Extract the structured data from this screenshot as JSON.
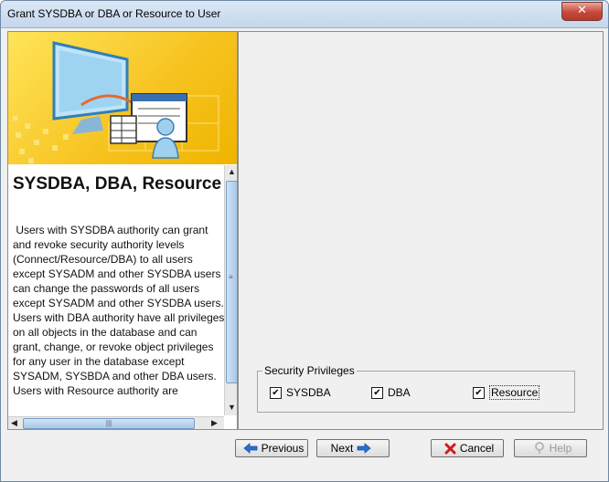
{
  "window": {
    "title": "Grant SYSDBA or DBA or Resource to User",
    "close_glyph": "✕"
  },
  "left_panel": {
    "heading": "SYSDBA, DBA, Resource Authority",
    "paragraphs": [
      " Users with SYSDBA authority can grant and revoke security authority levels (Connect/Resource/DBA) to all users except SYSADM and other SYSDBA users can change the passwords of all users except SYSADM and other SYSDBA users.",
      "Users with DBA authority have all privileges on all objects in the database and can grant, change, or revoke object privileges for any user in the database except SYSADM, SYSBDA and other DBA users.",
      "Users with Resource authority are"
    ],
    "scroll_left": "◀",
    "scroll_right": "▶",
    "scroll_up": "▲",
    "scroll_down": "▼",
    "grip_h": "|||",
    "grip_v": "≡"
  },
  "security": {
    "group_title": "Security Privileges",
    "items": [
      {
        "label": "SYSDBA",
        "checked": true
      },
      {
        "label": "DBA",
        "checked": true
      },
      {
        "label": "Resource",
        "checked": true
      }
    ],
    "check_glyph": "✔"
  },
  "buttons": {
    "previous": "Previous",
    "next": "Next",
    "cancel": "Cancel",
    "help": "Help"
  },
  "icons": {
    "previous": "arrow-left-icon",
    "next": "arrow-right-icon",
    "cancel": "red-x-icon",
    "help": "help-icon"
  },
  "colors": {
    "banner": "#f6c21e",
    "accent": "#2a6fd1",
    "cancel_x": "#d11a1a"
  }
}
